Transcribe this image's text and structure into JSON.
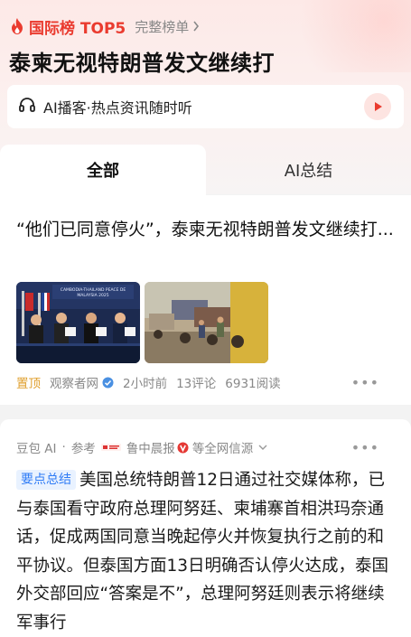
{
  "ranking": {
    "label": "国际榜 TOP5",
    "more_label": "完整榜单"
  },
  "headline": "泰柬无视特朗普发文继续打",
  "podcast": {
    "label": "AI播客·热点资讯随时听"
  },
  "tabs": [
    {
      "label": "全部",
      "active": true
    },
    {
      "label": "AI总结",
      "active": false
    }
  ],
  "article": {
    "title": "“他们已同意停火”，泰柬无视特朗普发文继续打...",
    "pin": "置顶",
    "source": "观察者网",
    "time": "2小时前",
    "comments": "13评论",
    "reads": "6931阅读",
    "image_caption": "CAMBODIA-THAILAND PEACE DE... MALAYSIA 2025"
  },
  "summary_card": {
    "source_ai": "豆包 AI",
    "separator": "·",
    "ref_label": "参考",
    "ref_source": "鲁中晨报",
    "ref_suffix": "等全网信源",
    "badge": "要点总结",
    "text": "美国总统特朗普12日通过社交媒体称，已与泰国看守政府总理阿努廷、柬埔寨首相洪玛奈通话，促成两国同意当晚起停火并恢复执行之前的和平协议。但泰国方面13日明确否认停火达成，泰国外交部回应“答案是不”，总理阿努廷则表示将继续军事行"
  },
  "colors": {
    "accent_red": "#ea3b2f",
    "link_blue": "#2f7cf6",
    "pin_orange": "#e0a030"
  }
}
